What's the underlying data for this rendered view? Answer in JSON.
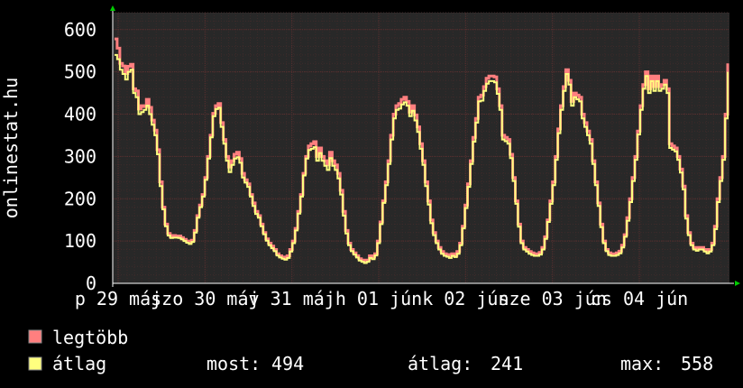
{
  "chart_data": {
    "type": "line",
    "ylabel": "onlinestat.hu",
    "ylim": [
      0,
      640
    ],
    "y_ticks": [
      "0",
      "100",
      "200",
      "300",
      "400",
      "500",
      "600"
    ],
    "x_tick_labels": [
      "p 29 máj",
      "szo 30 máj",
      "v 31 máj",
      "h 01 jún",
      "k 02 jún",
      "sze 03 jún",
      "cs 04 jún"
    ],
    "grid": true,
    "colors": {
      "background": "#000000",
      "plot_bg": "#282828",
      "grid": "#5a3030",
      "legtobb": "#ff7f7f",
      "atlag": "#ffff7f",
      "arrow": "#00cc00"
    },
    "series": [
      {
        "name": "legtöbb",
        "values": [
          578,
          556,
          520,
          514,
          496,
          513,
          518,
          460,
          455,
          412,
          420,
          418,
          435,
          416,
          386,
          362,
          316,
          240,
          180,
          140,
          118,
          110,
          113,
          112,
          112,
          108,
          104,
          100,
          98,
          102,
          125,
          160,
          185,
          210,
          250,
          300,
          350,
          402,
          420,
          425,
          380,
          340,
          300,
          275,
          290,
          305,
          310,
          295,
          260,
          245,
          235,
          210,
          190,
          170,
          160,
          140,
          120,
          105,
          95,
          88,
          80,
          70,
          65,
          62,
          60,
          65,
          80,
          100,
          130,
          170,
          210,
          260,
          300,
          325,
          330,
          335,
          300,
          320,
          300,
          290,
          280,
          310,
          290,
          280,
          260,
          220,
          170,
          125,
          95,
          80,
          72,
          65,
          58,
          55,
          52,
          55,
          65,
          62,
          70,
          100,
          145,
          195,
          240,
          290,
          350,
          400,
          420,
          425,
          435,
          440,
          430,
          405,
          420,
          398,
          370,
          330,
          290,
          240,
          195,
          150,
          120,
          100,
          85,
          75,
          70,
          68,
          65,
          70,
          66,
          75,
          95,
          135,
          185,
          235,
          290,
          345,
          390,
          440,
          445,
          465,
          485,
          490,
          490,
          488,
          460,
          420,
          350,
          345,
          340,
          305,
          250,
          195,
          140,
          100,
          85,
          80,
          75,
          72,
          70,
          70,
          73,
          85,
          110,
          150,
          195,
          240,
          300,
          365,
          420,
          465,
          505,
          480,
          430,
          450,
          445,
          440,
          400,
          380,
          360,
          340,
          290,
          240,
          190,
          140,
          100,
          80,
          72,
          70,
          70,
          72,
          76,
          90,
          115,
          155,
          200,
          250,
          300,
          360,
          420,
          470,
          500,
          460,
          490,
          465,
          490,
          465,
          470,
          480,
          460,
          330,
          325,
          320,
          300,
          270,
          230,
          160,
          120,
          95,
          85,
          82,
          85,
          85,
          80,
          76,
          80,
          95,
          135,
          200,
          250,
          300,
          400,
          520
        ]
      },
      {
        "name": "átlag",
        "values": [
          540,
          530,
          505,
          495,
          482,
          500,
          505,
          450,
          440,
          400,
          405,
          410,
          420,
          400,
          375,
          350,
          305,
          230,
          175,
          135,
          113,
          107,
          108,
          108,
          107,
          104,
          100,
          96,
          93,
          98,
          120,
          155,
          180,
          205,
          245,
          295,
          345,
          395,
          412,
          415,
          370,
          330,
          290,
          263,
          280,
          295,
          298,
          285,
          250,
          238,
          228,
          205,
          183,
          164,
          155,
          135,
          116,
          101,
          90,
          83,
          76,
          66,
          61,
          58,
          56,
          60,
          75,
          95,
          125,
          165,
          205,
          255,
          295,
          315,
          318,
          322,
          290,
          308,
          290,
          278,
          268,
          296,
          278,
          268,
          248,
          210,
          160,
          118,
          90,
          76,
          68,
          61,
          54,
          51,
          48,
          51,
          60,
          57,
          66,
          95,
          140,
          190,
          232,
          282,
          340,
          390,
          410,
          413,
          423,
          428,
          420,
          395,
          408,
          385,
          358,
          318,
          280,
          230,
          186,
          142,
          114,
          95,
          80,
          70,
          65,
          63,
          60,
          65,
          62,
          70,
          90,
          130,
          178,
          228,
          282,
          335,
          380,
          430,
          432,
          455,
          472,
          478,
          478,
          475,
          448,
          410,
          340,
          336,
          330,
          296,
          242,
          188,
          134,
          95,
          80,
          75,
          70,
          67,
          65,
          65,
          68,
          80,
          105,
          145,
          188,
          232,
          292,
          355,
          410,
          455,
          495,
          470,
          420,
          440,
          435,
          430,
          390,
          370,
          350,
          330,
          282,
          232,
          183,
          133,
          95,
          76,
          67,
          65,
          65,
          67,
          71,
          85,
          110,
          148,
          192,
          242,
          292,
          352,
          410,
          460,
          490,
          450,
          478,
          455,
          478,
          455,
          460,
          470,
          450,
          320,
          316,
          312,
          292,
          262,
          222,
          153,
          114,
          90,
          80,
          77,
          80,
          80,
          75,
          71,
          75,
          90,
          128,
          192,
          242,
          292,
          390,
          500
        ]
      }
    ]
  },
  "legend": {
    "items": [
      {
        "label": "legtöbb"
      },
      {
        "label": "átlag"
      }
    ],
    "stats": {
      "most_label": "most:",
      "most_value": "494",
      "atlag_label": "átlag:",
      "atlag_value": "241",
      "max_label": "max:",
      "max_value": "558"
    }
  }
}
